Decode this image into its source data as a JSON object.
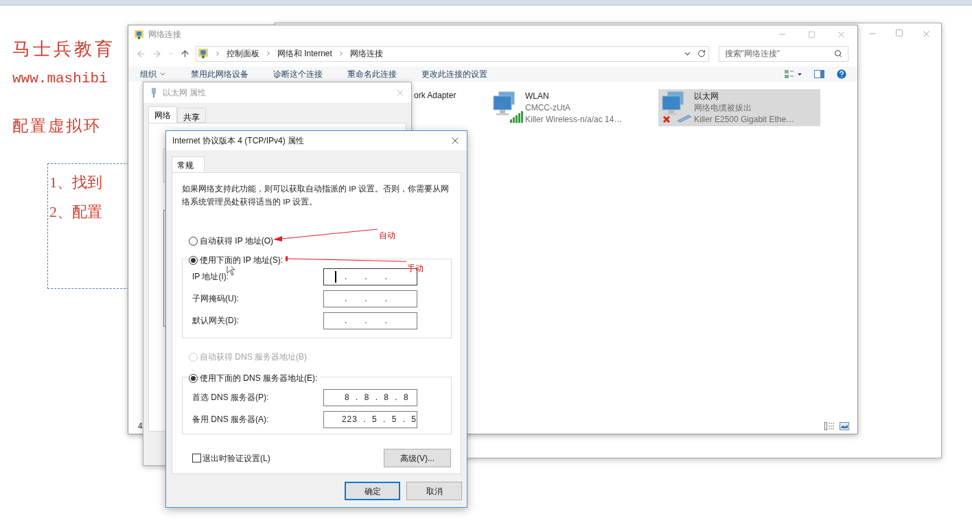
{
  "slide": {
    "title": "马士兵教育",
    "url": "www.mashibi",
    "heading": "配置虚拟环",
    "steps": [
      "1、找到",
      "2、配置"
    ]
  },
  "explorer": {
    "title": "网络连接",
    "breadcrumb": [
      "控制面板",
      "网络和 Internet",
      "网络连接"
    ],
    "search": {
      "placeholder": "搜索\"网络连接\""
    },
    "toolbar": [
      {
        "label": "组织",
        "menu": true
      },
      {
        "label": "禁用此网络设备",
        "menu": false
      },
      {
        "label": "诊断这个连接",
        "menu": false
      },
      {
        "label": "重命名此连接",
        "menu": false
      },
      {
        "label": "更改此连接的设置",
        "menu": false
      }
    ],
    "items": [
      {
        "kind": "partial",
        "name": "ork Adapter",
        "selected": false
      },
      {
        "kind": "wireless",
        "name": "WLAN",
        "status": "CMCC-zUtA",
        "device": "Killer Wireless-n/a/ac 14…",
        "selected": false,
        "connected": true
      },
      {
        "kind": "ethernet",
        "name": "以太网",
        "status": "网络电缆被拔出",
        "device": "Killer E2500 Gigabit Ethe…",
        "selected": true,
        "connected": false
      }
    ],
    "status_bar": {
      "count": "4"
    }
  },
  "eth_properties": {
    "title": "以太网 属性",
    "tabs": [
      {
        "label": "网络",
        "selected": true
      },
      {
        "label": "共享",
        "selected": false
      }
    ]
  },
  "ipv4": {
    "title": "Internet 协议版本 4 (TCP/IPv4) 属性",
    "tabs": [
      {
        "label": "常规",
        "selected": true
      }
    ],
    "description": "如果网络支持此功能，则可以获取自动指派的 IP 设置。否则，你需要从网络系统管理员处获得适当的 IP 设置。",
    "ip_options": [
      {
        "label": "自动获得 IP 地址(O)",
        "selected": false,
        "disabled": false
      },
      {
        "label": "使用下面的 IP 地址(S):",
        "selected": true,
        "disabled": false
      }
    ],
    "ip_fields": [
      {
        "label": "IP 地址(I):",
        "value": ".   .   .",
        "focused": true
      },
      {
        "label": "子网掩码(U):",
        "value": ".   .   .",
        "focused": false
      },
      {
        "label": "默认网关(D):",
        "value": ".   .   .",
        "focused": false
      }
    ],
    "dns_options": [
      {
        "label": "自动获得 DNS 服务器地址(B)",
        "selected": false,
        "disabled": true
      },
      {
        "label": "使用下面的 DNS 服务器地址(E):",
        "selected": true,
        "disabled": false
      }
    ],
    "dns_fields": [
      {
        "label": "首选 DNS 服务器(P):",
        "value": "8 . 8 . 8 . 8",
        "focused": false
      },
      {
        "label": "备用 DNS 服务器(A):",
        "value": "223 . 5 . 5 . 5",
        "focused": false
      }
    ],
    "validate": {
      "label": "退出时验证设置(L)",
      "checked": false
    },
    "advanced": "高级(V)...",
    "buttons": [
      {
        "label": "确定",
        "default": true
      },
      {
        "label": "取消",
        "default": false
      }
    ]
  },
  "annotations": [
    {
      "label": "自动"
    },
    {
      "label": "手动"
    }
  ]
}
